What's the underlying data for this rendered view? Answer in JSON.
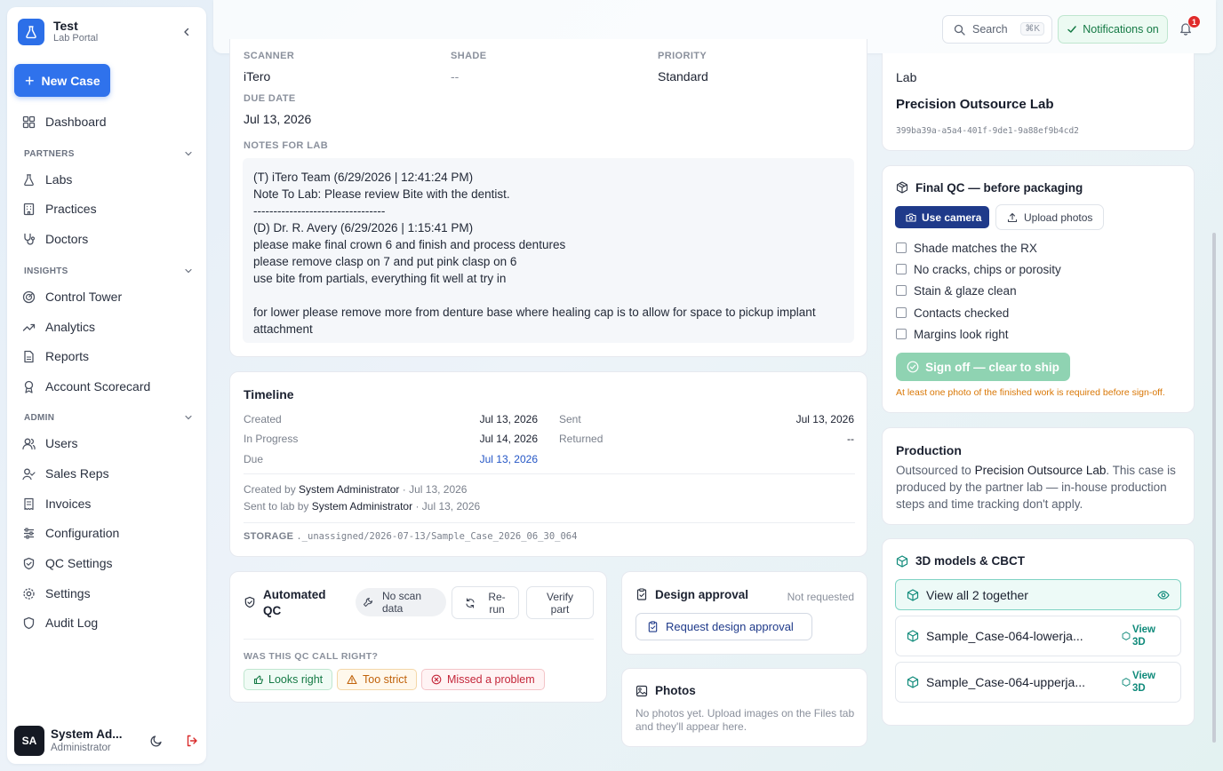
{
  "brand": {
    "name": "Test",
    "subtitle": "Lab Portal"
  },
  "sidebar": {
    "new_case_label": "New Case",
    "dashboard": "Dashboard",
    "sections": [
      {
        "title": "PARTNERS",
        "items": [
          "Labs",
          "Practices",
          "Doctors"
        ]
      },
      {
        "title": "INSIGHTS",
        "items": [
          "Control Tower",
          "Analytics",
          "Reports",
          "Account Scorecard"
        ]
      },
      {
        "title": "ADMIN",
        "items": [
          "Users",
          "Sales Reps",
          "Invoices",
          "Configuration",
          "QC Settings",
          "Settings",
          "Audit Log"
        ]
      }
    ],
    "user": {
      "initials": "SA",
      "name": "System Ad...",
      "role": "Administrator"
    }
  },
  "topbar": {
    "search_label": "Search",
    "search_shortcut": "⌘K",
    "notifications_label": "Notifications on",
    "notification_count": "1"
  },
  "details": {
    "scanner_label": "SCANNER",
    "scanner_value": "iTero",
    "shade_label": "SHADE",
    "shade_value": "--",
    "priority_label": "PRIORITY",
    "priority_value": "Standard",
    "due_label": "DUE DATE",
    "due_value": "Jul 13, 2026",
    "notes_label": "NOTES FOR LAB",
    "notes_lines": [
      "(T) iTero Team (6/29/2026 | 12:41:24 PM)",
      "Note To Lab: Please review Bite with the dentist.",
      "---------------------------------",
      "(D) Dr. R. Avery (6/29/2026 | 1:15:41 PM)",
      "please make final crown 6 and finish and process dentures",
      "please remove clasp on 7 and put pink clasp on 6",
      "use bite from partials, everything fit well at try in",
      "",
      "for lower please remove more from denture base where healing cap is to allow for space to pickup implant attachment"
    ]
  },
  "timeline": {
    "title": "Timeline",
    "created_label": "Created",
    "created_value": "Jul 13, 2026",
    "sent_label": "Sent",
    "sent_value": "Jul 13, 2026",
    "in_progress_label": "In Progress",
    "in_progress_value": "Jul 14, 2026",
    "returned_label": "Returned",
    "returned_value": "--",
    "due_label": "Due",
    "due_value": "Jul 13, 2026",
    "created_by_prefix": "Created by",
    "created_by_name": "System Administrator",
    "created_by_date": "· Jul 13, 2026",
    "sent_by_prefix": "Sent to lab by",
    "sent_by_name": "System Administrator",
    "sent_by_date": "· Jul 13, 2026",
    "storage_label": "STORAGE",
    "storage_path": "._unassigned/2026-07-13/Sample_Case_2026_06_30_064"
  },
  "auto_qc": {
    "title_line1": "Automated",
    "title_line2": "QC",
    "status_line1": "No scan",
    "status_line2": "data",
    "rerun_line1": "Re-",
    "rerun_line2": "run",
    "verify_line1": "Verify",
    "verify_line2": "part",
    "question": "WAS THIS QC CALL RIGHT?",
    "fb_right": "Looks right",
    "fb_strict": "Too strict",
    "fb_missed": "Missed a problem"
  },
  "design_approval": {
    "title": "Design approval",
    "status": "Not requested",
    "button": "Request design approval"
  },
  "photos": {
    "title": "Photos",
    "empty_text": "No photos yet. Upload images on the Files tab and they'll appear here."
  },
  "lab": {
    "label": "Lab",
    "name": "Precision Outsource Lab",
    "id": "399ba39a-a5a4-401f-9de1-9a88ef9b4cd2"
  },
  "final_qc": {
    "title": "Final QC — before packaging",
    "camera_button": "Use camera",
    "upload_button": "Upload photos",
    "checks": [
      "Shade matches the RX",
      "No cracks, chips or porosity",
      "Stain & glaze clean",
      "Contacts checked",
      "Margins look right"
    ],
    "signoff_button": "Sign off — clear to ship",
    "warning": "At least one photo of the finished work is required before sign-off."
  },
  "production": {
    "title": "Production",
    "text_before": "Outsourced to ",
    "lab_name": "Precision Outsource Lab",
    "text_after": ". This case is produced by the partner lab — in-house production steps and time tracking don't apply."
  },
  "models": {
    "title": "3D models & CBCT",
    "view_all": "View all 2 together",
    "files": [
      {
        "name": "Sample_Case-064-lowerja...",
        "action_line1": "View",
        "action_line2": "3D"
      },
      {
        "name": "Sample_Case-064-upperja...",
        "action_line1": "View",
        "action_line2": "3D"
      }
    ]
  },
  "colors": {
    "accent": "#2f72ec",
    "dark_button": "#1f3a8a",
    "success": "#157a45",
    "warning": "#d97706",
    "danger": "#e02b2b"
  }
}
